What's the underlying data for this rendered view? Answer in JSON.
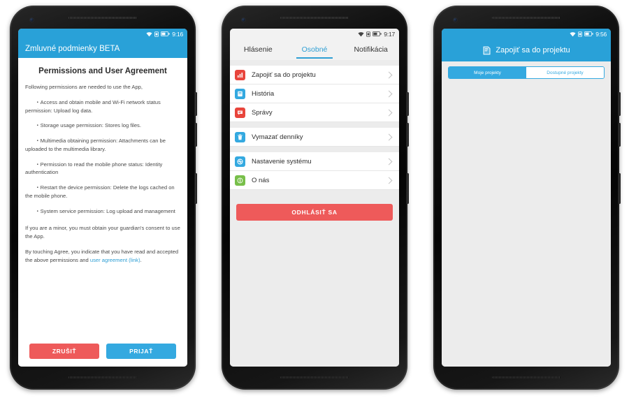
{
  "theme": {
    "blue": "#29a1d8",
    "blue_accent": "#34a9e0",
    "red": "#ee5a5a",
    "link_blue": "#2f9fd4",
    "screen_bg": "#ececec"
  },
  "phone1": {
    "status": {
      "time": "9:16",
      "wifi": "wifi-icon",
      "sim": "sim-card-icon",
      "battery": "battery-icon"
    },
    "appbar": {
      "title": "Zmluvné podmienky BETA"
    },
    "doc": {
      "heading": "Permissions and User Agreement",
      "intro": "Following permissions are needed to use the App,",
      "bullets": [
        "・Access and obtain mobile and Wi-Fi network status permission: Upload log data.",
        "・Storage usage permission: Stores log files.",
        "・Multimedia obtaining permission: Attachments can be uploaded to the multimedia library.",
        "・Permission to read the mobile phone status: Identity authentication",
        "・Restart the device permission: Delete the logs cached on the mobile phone.",
        "・System service permission: Log upload and management"
      ],
      "minor_note": "If you are a minor, you must obtain your guardian's consent to use the App.",
      "agree_prefix": "By touching Agree, you indicate that you have read and accepted the above permissions and ",
      "agree_link": "user agreement (link)",
      "agree_suffix": "."
    },
    "actions": {
      "cancel": "ZRUŠIŤ",
      "accept": "PRIJAŤ"
    }
  },
  "phone2": {
    "status": {
      "time": "9:17",
      "wifi": "wifi-icon",
      "sim": "sim-card-icon",
      "battery": "battery-icon"
    },
    "tabs": [
      {
        "label": "Hlásenie",
        "active": false
      },
      {
        "label": "Osobné",
        "active": true
      },
      {
        "label": "Notifikácia",
        "active": false
      }
    ],
    "groups": [
      {
        "items": [
          {
            "label": "Zapojiť sa do projektu",
            "icon": "chart-bars-icon",
            "icon_color": "#e8453c"
          },
          {
            "label": "História",
            "icon": "book-icon",
            "icon_color": "#34a9e0"
          },
          {
            "label": "Správy",
            "icon": "chat-bubble-icon",
            "icon_color": "#e8453c"
          }
        ]
      },
      {
        "items": [
          {
            "label": "Vymazať denníky",
            "icon": "trash-icon",
            "icon_color": "#34a9e0"
          }
        ]
      },
      {
        "items": [
          {
            "label": "Nastavenie systému",
            "icon": "settings-globe-icon",
            "icon_color": "#34a9e0"
          },
          {
            "label": "O nás",
            "icon": "info-power-icon",
            "icon_color": "#78bf4a"
          }
        ]
      }
    ],
    "logout_label": "ODHLÁSIŤ SA"
  },
  "phone3": {
    "status": {
      "time": "9:56",
      "wifi": "wifi-icon",
      "sim": "sim-card-icon",
      "battery": "battery-icon"
    },
    "appbar": {
      "title": "Zapojiť sa do projektu",
      "icon": "document-icon"
    },
    "segments": [
      {
        "label": "Moje projekty",
        "active": true
      },
      {
        "label": "Dostupné projekty",
        "active": false
      }
    ]
  }
}
